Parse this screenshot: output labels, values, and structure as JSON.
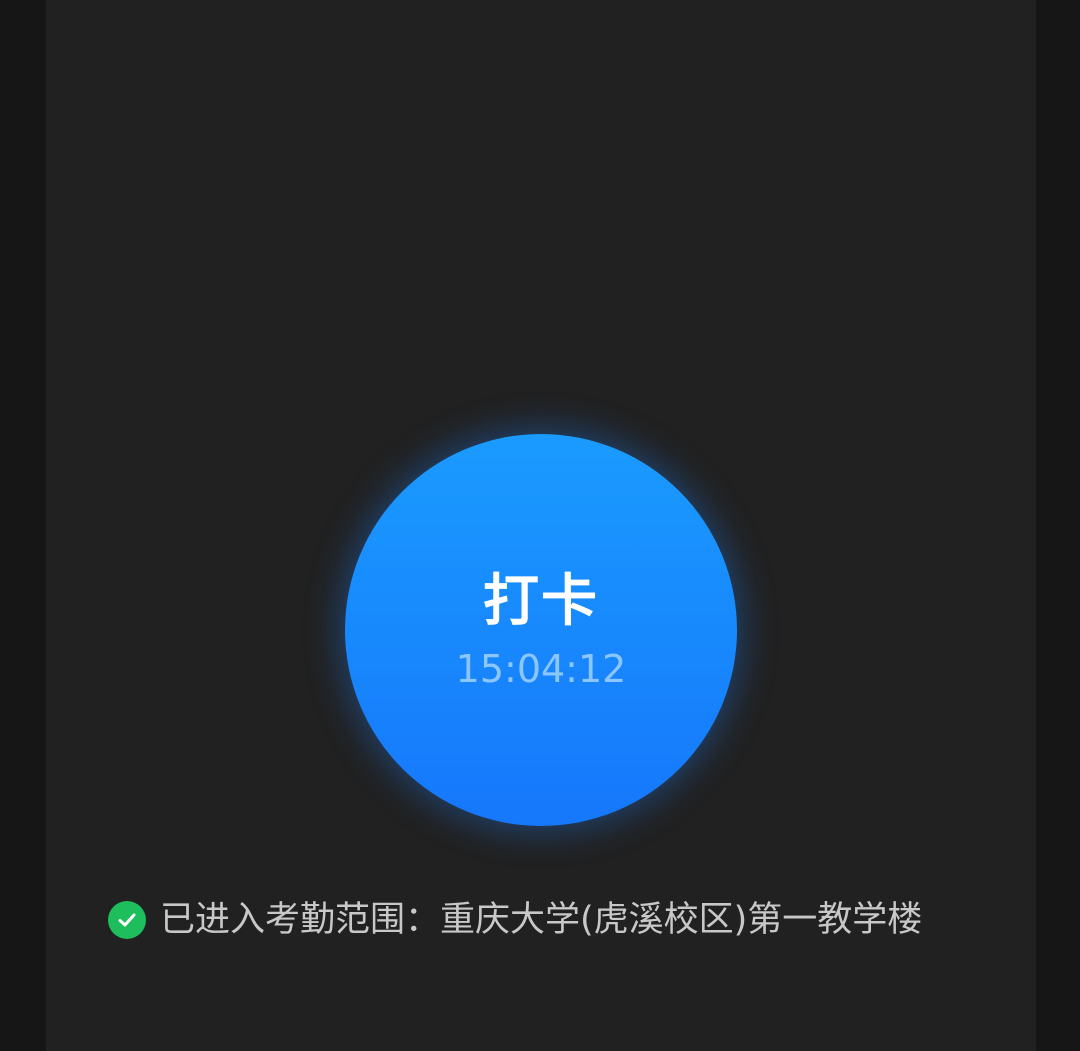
{
  "punch": {
    "label": "打卡",
    "time": "15:04:12"
  },
  "status": {
    "icon": "check-circle-icon",
    "text": "已进入考勤范围：重庆大学(虎溪校区)第一教学楼",
    "icon_color": "#1dbe5b"
  },
  "colors": {
    "background": "#212121",
    "button_top": "#1a9bff",
    "button_bottom": "#1677fb"
  }
}
